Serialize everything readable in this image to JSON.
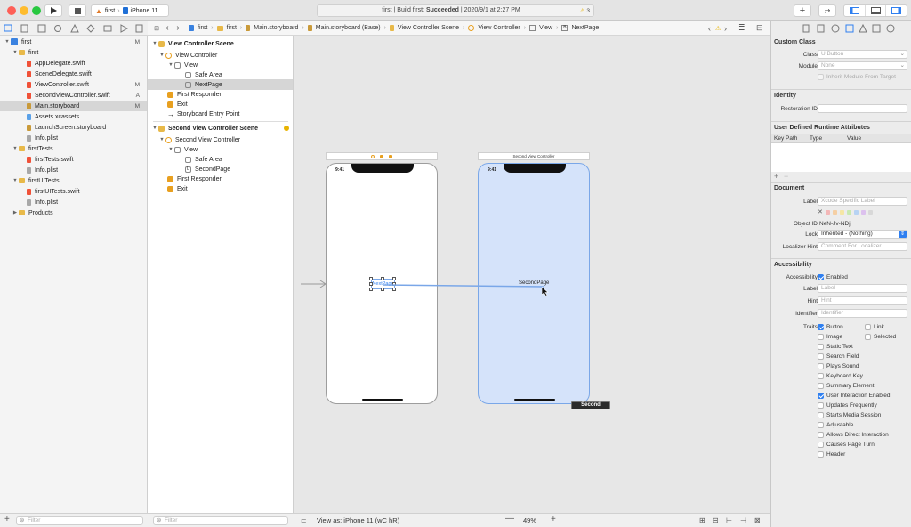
{
  "toolbar": {
    "scheme": "first",
    "device": "iPhone 11",
    "status_prefix": "first | Build first: ",
    "status_bold": "Succeeded",
    "status_date": " | 2020/9/1 at 2:27 PM",
    "warning_count": "3"
  },
  "navigator": {
    "items": [
      {
        "label": "first",
        "badge": "M"
      },
      {
        "label": "first",
        "badge": ""
      },
      {
        "label": "AppDelegate.swift",
        "badge": ""
      },
      {
        "label": "SceneDelegate.swift",
        "badge": ""
      },
      {
        "label": "ViewController.swift",
        "badge": "M"
      },
      {
        "label": "SecondViewController.swift",
        "badge": "A"
      },
      {
        "label": "Main.storyboard",
        "badge": "M"
      },
      {
        "label": "Assets.xcassets",
        "badge": ""
      },
      {
        "label": "LaunchScreen.storyboard",
        "badge": ""
      },
      {
        "label": "Info.plist",
        "badge": ""
      },
      {
        "label": "firstTests",
        "badge": ""
      },
      {
        "label": "firstTests.swift",
        "badge": ""
      },
      {
        "label": "Info.plist",
        "badge": ""
      },
      {
        "label": "firstUITests",
        "badge": ""
      },
      {
        "label": "firstUITests.swift",
        "badge": ""
      },
      {
        "label": "Info.plist",
        "badge": ""
      },
      {
        "label": "Products",
        "badge": ""
      }
    ],
    "filter_placeholder": "Filter"
  },
  "jumpbar": {
    "crumbs": [
      "first",
      "first",
      "Main.storyboard",
      "Main.storyboard (Base)",
      "View Controller Scene",
      "View Controller",
      "View",
      "NextPage"
    ]
  },
  "outline": {
    "items": [
      "View Controller Scene",
      "View Controller",
      "View",
      "Safe Area",
      "NextPage",
      "First Responder",
      "Exit",
      "Storyboard Entry Point",
      "Second View Controller Scene",
      "Second View Controller",
      "View",
      "Safe Area",
      "SecondPage",
      "First Responder",
      "Exit"
    ],
    "filter_placeholder": "Filter"
  },
  "canvas": {
    "scene2_title": "Second View Controller",
    "time1": "9:41",
    "time2": "9:41",
    "button_label": "NextPage",
    "label2": "SecondPage",
    "segue_tooltip": "Second",
    "view_as": "View as: iPhone 11 (",
    "view_as_suffix": "wC hR)",
    "zoom": "49%"
  },
  "inspector": {
    "custom_class": "Custom Class",
    "class_label": "Class",
    "class_value": "UIButton",
    "module_label": "Module",
    "module_value": "None",
    "inherit_label": "Inherit Module From Target",
    "identity": "Identity",
    "restoration_label": "Restoration ID",
    "udra": "User Defined Runtime Attributes",
    "col_keypath": "Key Path",
    "col_type": "Type",
    "col_value": "Value",
    "document": "Document",
    "label_label": "Label",
    "label_placeholder": "Xcode Specific Label",
    "object_id_label": "Object ID",
    "object_id_value": "NeN-Jv-NDj",
    "lock_label": "Lock",
    "lock_value": "Inherited - (Nothing)",
    "localizer_label": "Localizer Hint",
    "localizer_placeholder": "Comment For Localizer",
    "accessibility": "Accessibility",
    "acc_label": "Accessibility",
    "enabled": "Enabled",
    "acc_label_label": "Label",
    "acc_label_ph": "Label",
    "hint_label": "Hint",
    "hint_ph": "Hint",
    "identifier_label": "Identifier",
    "identifier_ph": "Identifier",
    "traits_label": "Traits",
    "traits": [
      {
        "name": "Button",
        "checked": true
      },
      {
        "name": "Image",
        "checked": false
      },
      {
        "name": "Static Text",
        "checked": false
      },
      {
        "name": "Search Field",
        "checked": false
      },
      {
        "name": "Plays Sound",
        "checked": false
      },
      {
        "name": "Keyboard Key",
        "checked": false
      },
      {
        "name": "Summary Element",
        "checked": false
      },
      {
        "name": "User Interaction Enabled",
        "checked": true
      },
      {
        "name": "Updates Frequently",
        "checked": false
      },
      {
        "name": "Starts Media Session",
        "checked": false
      },
      {
        "name": "Adjustable",
        "checked": false
      },
      {
        "name": "Allows Direct Interaction",
        "checked": false
      },
      {
        "name": "Causes Page Turn",
        "checked": false
      },
      {
        "name": "Header",
        "checked": false
      }
    ],
    "traits_right": [
      {
        "name": "Link",
        "checked": false
      },
      {
        "name": "Selected",
        "checked": false
      }
    ]
  },
  "colors": {
    "accent": "#2f7ff0",
    "selected_scene_bg": "#d5e3fa",
    "folder": "#e8b949",
    "swift": "#f05138"
  }
}
